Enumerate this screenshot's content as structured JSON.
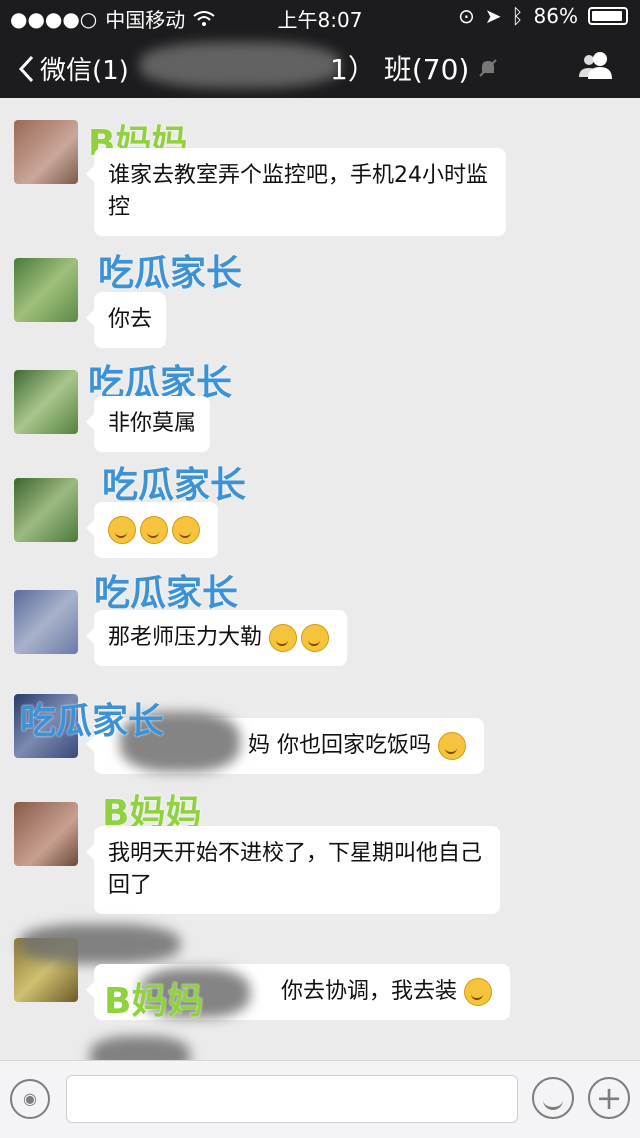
{
  "status_bar": {
    "carrier": "中国移动",
    "time": "上午8:07",
    "battery": "86%"
  },
  "nav": {
    "back_label": "微信(1)",
    "title_partial": "1）",
    "title_main": "班(70)"
  },
  "messages": [
    {
      "sender": "B妈妈",
      "text": "谁家去教室弄个监控吧，手机24小时监控"
    },
    {
      "sender": "吃瓜家长",
      "text": "你去"
    },
    {
      "sender": "吃瓜家长",
      "text": "非你莫属"
    },
    {
      "sender": "吃瓜家长",
      "text": ""
    },
    {
      "sender": "吃瓜家长",
      "text": "那老师压力大勒"
    },
    {
      "sender": "吃瓜家长",
      "text": "妈 你也回家吃饭吗"
    },
    {
      "sender": "B妈妈",
      "text": "我明天开始不进校了，下星期叫他自己回了"
    },
    {
      "sender": "B妈妈",
      "text": "你去协调，我去装"
    }
  ],
  "colors": {
    "accent_blue": "#3c92d6",
    "accent_green": "#8fd23e",
    "navbar_bg": "#1c1c1e"
  }
}
